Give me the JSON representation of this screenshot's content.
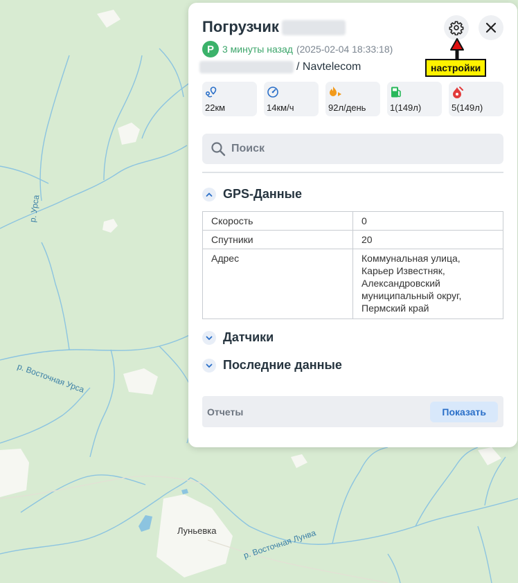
{
  "map": {
    "labels": {
      "river_ursa": "р. Урса",
      "river_east_ursa": "р. Восточная Урса",
      "town": "Луньевка",
      "river_east_lunva": "р. Восточная Лунва"
    },
    "colors": {
      "land": "#d8ebd2",
      "water": "#8cc4e0",
      "clearing": "#f6f7f2"
    }
  },
  "card": {
    "title": "Погрузчик",
    "status": {
      "badge": "P",
      "ago": "3 минуты назад",
      "datetime": "(2025-02-04 18:33:18)",
      "badge_color": "#3bb26a"
    },
    "device": "/ Navtelecom",
    "annotation": "настройки",
    "stats": [
      {
        "icon": "route-icon",
        "value": "22км"
      },
      {
        "icon": "speedometer-icon",
        "value": "14км/ч"
      },
      {
        "icon": "fuel-flame-icon",
        "value": "92л/день"
      },
      {
        "icon": "fuel-station-icon",
        "value": "1(149л)"
      },
      {
        "icon": "fuel-drain-icon",
        "value": "5(149л)"
      }
    ],
    "search": {
      "placeholder": "Поиск"
    },
    "sections": {
      "gps": "GPS-Данные",
      "sensors": "Датчики",
      "last_data": "Последние данные"
    },
    "gps_table": [
      {
        "key": "Скорость",
        "value": "0"
      },
      {
        "key": "Спутники",
        "value": "20"
      },
      {
        "key": "Адрес",
        "value": "Коммунальная улица, Карьер Известняк, Александровский муниципальный округ, Пермский край"
      }
    ],
    "footer": {
      "label": "Отчеты",
      "button": "Показать"
    },
    "accent_color": "#2a6fc8"
  }
}
